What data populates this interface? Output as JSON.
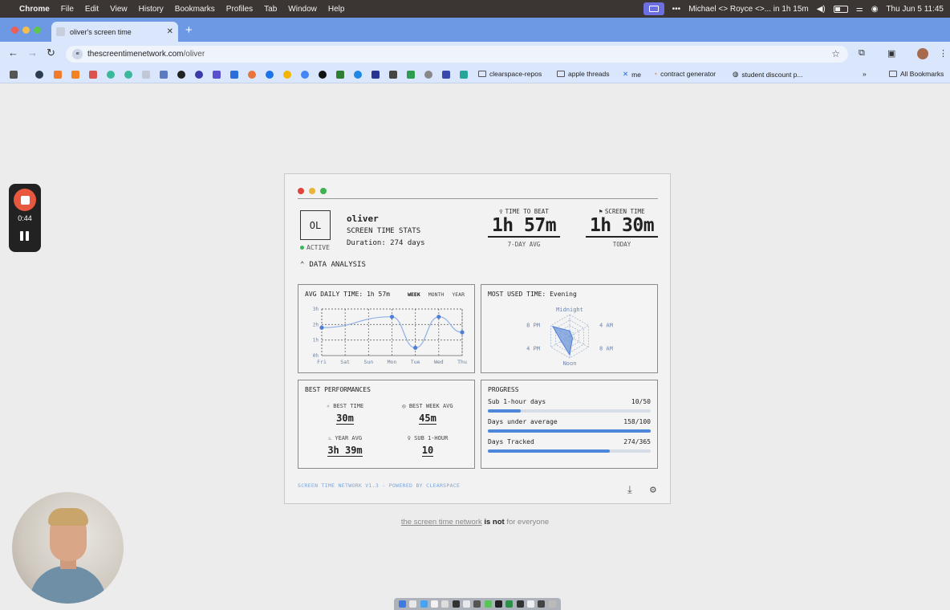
{
  "menubar": {
    "app": "Chrome",
    "items": [
      "File",
      "Edit",
      "View",
      "History",
      "Bookmarks",
      "Profiles",
      "Tab",
      "Window",
      "Help"
    ],
    "meeting": "Michael <> Royce <>... in 1h 15m",
    "datetime": "Thu Jun 5  11:45"
  },
  "browser": {
    "tab_title": "oliver's screen time",
    "url_host": "thescreentimenetwork.com",
    "url_path": "/oliver",
    "bookmarks": [
      "clearspace-repos",
      "apple threads",
      "me",
      "contract generator",
      "student discount p...",
      "All Bookmarks"
    ]
  },
  "recorder": {
    "elapsed": "0:44"
  },
  "profile": {
    "initials": "OL",
    "status": "ACTIVE",
    "name": "oliver",
    "subtitle": "SCREEN TIME STATS",
    "duration": "Duration: 274 days"
  },
  "stats": {
    "time_to_beat": {
      "label": "TIME TO BEAT",
      "value": "1h 57m",
      "caption": "7-DAY AVG"
    },
    "screen_time": {
      "label": "SCREEN TIME",
      "value": "1h 30m",
      "caption": "TODAY"
    }
  },
  "data_analysis_label": "DATA ANALYSIS",
  "avg_panel": {
    "title": "AVG DAILY TIME: 1h 57m",
    "range_tabs": [
      "WEEK",
      "MONTH",
      "YEAR"
    ],
    "selected_range": "WEEK"
  },
  "chart_data": {
    "type": "line",
    "categories": [
      "Fri",
      "Sat",
      "Sun",
      "Mon",
      "Tue",
      "Wed",
      "Thu"
    ],
    "y_ticks": [
      "3h",
      "2h",
      "1h",
      "0h"
    ],
    "ylim": [
      0,
      3
    ],
    "points": [
      {
        "day": "Fri",
        "hours": 1.8
      },
      {
        "day": "Mon",
        "hours": 2.5
      },
      {
        "day": "Tue",
        "hours": 0.5
      },
      {
        "day": "Wed",
        "hours": 2.5
      },
      {
        "day": "Thu",
        "hours": 1.5
      }
    ],
    "color": "#4e7fd6"
  },
  "most_used": {
    "title": "MOST USED TIME: Evening",
    "labels": {
      "top": "Midnight",
      "upper_right": "4 AM",
      "lower_right": "8 AM",
      "bottom": "Noon",
      "lower_left": "4 PM",
      "upper_left": "8 PM"
    },
    "radar_values": [
      0.25,
      0.1,
      0.15,
      0.85,
      0.45,
      0.9
    ]
  },
  "best_performances": {
    "title": "BEST PERFORMANCES",
    "items": [
      {
        "label": "BEST TIME",
        "value": "30m"
      },
      {
        "label": "BEST WEEK AVG",
        "value": "45m"
      },
      {
        "label": "YEAR AVG",
        "value": "3h 39m"
      },
      {
        "label": "SUB 1-HOUR",
        "value": "10"
      }
    ]
  },
  "progress": {
    "title": "PROGRESS",
    "rows": [
      {
        "label": "Sub 1-hour days",
        "value": "10/50",
        "fraction": 0.2
      },
      {
        "label": "Days under average",
        "value": "158/100",
        "fraction": 1.0
      },
      {
        "label": "Days Tracked",
        "value": "274/365",
        "fraction": 0.75
      }
    ]
  },
  "footer": "SCREEN TIME NETWORK V1.3 - POWERED BY CLEARSPACE",
  "tagline": {
    "link": "the screen time network",
    "bold": "is not",
    "rest": "for everyone"
  },
  "colors": {
    "accent": "#4e86da",
    "active": "#39b35c",
    "tab_strip": "#6d99e4"
  }
}
